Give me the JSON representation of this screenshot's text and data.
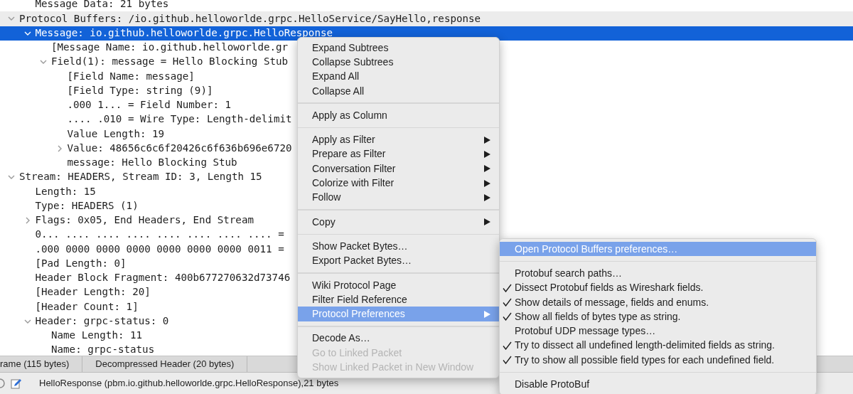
{
  "tree": [
    {
      "children": [
        {
          "label": "Message Data: 21 bytes",
          "selected": false
        }
      ]
    },
    {
      "label": "Protocol Buffers: /io.github.helloworlde.grpc.HelloService/SayHello,response",
      "selected": false,
      "shaded": true,
      "expanded": true,
      "children": [
        {
          "label": "Message: io.github.helloworlde.grpc.HelloResponse",
          "selected": true,
          "expanded": true,
          "children": [
            {
              "label": "[Message Name: io.github.helloworlde.gr",
              "selected": false
            },
            {
              "label": "Field(1): message = Hello Blocking Stub",
              "selected": false,
              "expanded": true,
              "children": [
                {
                  "label": "[Field Name: message]",
                  "selected": false
                },
                {
                  "label": "[Field Type: string (9)]",
                  "selected": false
                },
                {
                  "label": ".000 1... = Field Number: 1",
                  "selected": false
                },
                {
                  "label": ".... .010 = Wire Type: Length-delimit",
                  "selected": false
                },
                {
                  "label": "Value Length: 19",
                  "selected": false
                },
                {
                  "label": "Value: 48656c6c6f20426c6f636b696e6720",
                  "selected": false,
                  "expanded": false
                },
                {
                  "label": "message: Hello Blocking Stub",
                  "selected": false
                }
              ]
            }
          ]
        }
      ]
    },
    {
      "label": "Stream: HEADERS, Stream ID: 3, Length 15",
      "selected": false,
      "expanded": true,
      "children": [
        {
          "label": "Length: 15",
          "selected": false
        },
        {
          "label": "Type: HEADERS (1)",
          "selected": false
        },
        {
          "label": "Flags: 0x05, End Headers, End Stream",
          "selected": false,
          "expanded": false
        },
        {
          "label": "0... .... .... .... .... .... .... .... =",
          "selected": false
        },
        {
          "label": ".000 0000 0000 0000 0000 0000 0000 0011 =",
          "selected": false
        },
        {
          "label": "[Pad Length: 0]",
          "selected": false
        },
        {
          "label": "Header Block Fragment: 400b677270632d73746",
          "selected": false
        },
        {
          "label": "[Header Length: 20]",
          "selected": false
        },
        {
          "label": "[Header Count: 1]",
          "selected": false
        },
        {
          "label": "Header: grpc-status: 0",
          "selected": false,
          "expanded": true,
          "children": [
            {
              "label": "Name Length: 11",
              "selected": false
            },
            {
              "label": "Name: grpc-status",
              "selected": false
            }
          ]
        }
      ]
    }
  ],
  "byte_tabs": [
    {
      "label": "rame (115 bytes)"
    },
    {
      "label": "Decompressed Header (20 bytes)"
    }
  ],
  "status_bar": {
    "text": "HelloResponse (pbm.io.github.helloworlde.grpc.HelloResponse),21 bytes"
  },
  "menu": {
    "items": [
      {
        "kind": "item",
        "label": "Expand Subtrees",
        "submenu": false,
        "disabled": false,
        "selected": false
      },
      {
        "kind": "item",
        "label": "Collapse Subtrees",
        "submenu": false,
        "disabled": false,
        "selected": false
      },
      {
        "kind": "item",
        "label": "Expand All",
        "submenu": false,
        "disabled": false,
        "selected": false
      },
      {
        "kind": "item",
        "label": "Collapse All",
        "submenu": false,
        "disabled": false,
        "selected": false
      },
      {
        "kind": "separator"
      },
      {
        "kind": "item",
        "label": "Apply as Column",
        "submenu": false,
        "disabled": false,
        "selected": false
      },
      {
        "kind": "separator"
      },
      {
        "kind": "item",
        "label": "Apply as Filter",
        "submenu": true,
        "disabled": false,
        "selected": false
      },
      {
        "kind": "item",
        "label": "Prepare as Filter",
        "submenu": true,
        "disabled": false,
        "selected": false
      },
      {
        "kind": "item",
        "label": "Conversation Filter",
        "submenu": true,
        "disabled": false,
        "selected": false
      },
      {
        "kind": "item",
        "label": "Colorize with Filter",
        "submenu": true,
        "disabled": false,
        "selected": false
      },
      {
        "kind": "item",
        "label": "Follow",
        "submenu": true,
        "disabled": false,
        "selected": false
      },
      {
        "kind": "separator"
      },
      {
        "kind": "item",
        "label": "Copy",
        "submenu": true,
        "disabled": false,
        "selected": false
      },
      {
        "kind": "separator"
      },
      {
        "kind": "item",
        "label": "Show Packet Bytes…",
        "submenu": false,
        "disabled": false,
        "selected": false
      },
      {
        "kind": "item",
        "label": "Export Packet Bytes…",
        "submenu": false,
        "disabled": false,
        "selected": false
      },
      {
        "kind": "separator"
      },
      {
        "kind": "item",
        "label": "Wiki Protocol Page",
        "submenu": false,
        "disabled": false,
        "selected": false
      },
      {
        "kind": "item",
        "label": "Filter Field Reference",
        "submenu": false,
        "disabled": false,
        "selected": false
      },
      {
        "kind": "item",
        "label": "Protocol Preferences",
        "submenu": true,
        "disabled": false,
        "selected": true
      },
      {
        "kind": "separator"
      },
      {
        "kind": "item",
        "label": "Decode As…",
        "submenu": false,
        "disabled": false,
        "selected": false
      },
      {
        "kind": "item",
        "label": "Go to Linked Packet",
        "submenu": false,
        "disabled": true,
        "selected": false
      },
      {
        "kind": "item",
        "label": "Show Linked Packet in New Window",
        "submenu": false,
        "disabled": true,
        "selected": false
      }
    ]
  },
  "submenu": {
    "items": [
      {
        "kind": "item",
        "label": "Open Protocol Buffers preferences…",
        "checked": false,
        "selected": true
      },
      {
        "kind": "separator"
      },
      {
        "kind": "item",
        "label": "Protobuf search paths…",
        "checked": false,
        "selected": false
      },
      {
        "kind": "item",
        "label": "Dissect Protobuf fields as Wireshark fields.",
        "checked": true,
        "selected": false
      },
      {
        "kind": "item",
        "label": "Show details of message, fields and enums.",
        "checked": true,
        "selected": false
      },
      {
        "kind": "item",
        "label": "Show all fields of bytes type as string.",
        "checked": true,
        "selected": false
      },
      {
        "kind": "item",
        "label": "Protobuf UDP message types…",
        "checked": false,
        "selected": false
      },
      {
        "kind": "item",
        "label": "Try to dissect all undefined length-delimited fields as string.",
        "checked": true,
        "selected": false
      },
      {
        "kind": "item",
        "label": "Try to show all possible field types for each undefined field.",
        "checked": true,
        "selected": false
      },
      {
        "kind": "separator"
      },
      {
        "kind": "item",
        "label": "Disable ProtoBuf",
        "checked": false,
        "selected": false
      }
    ]
  }
}
